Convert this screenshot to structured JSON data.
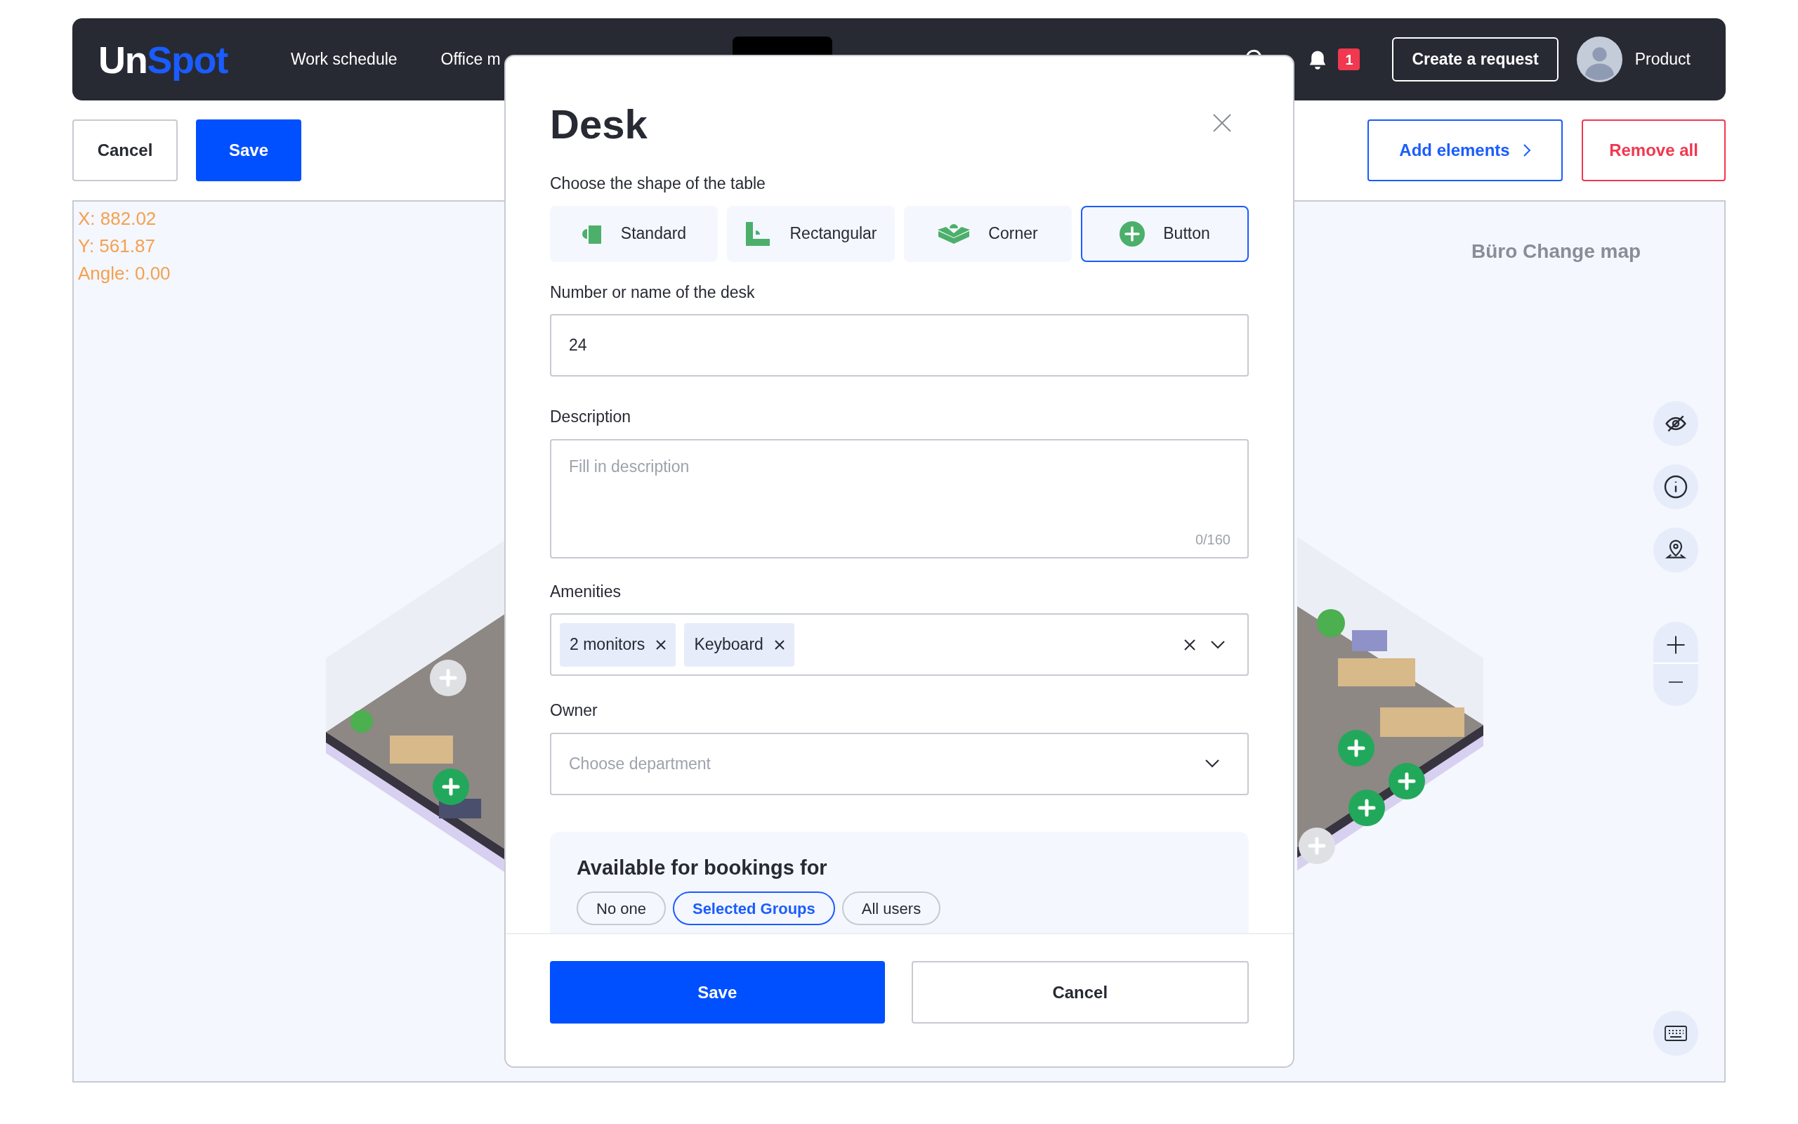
{
  "header": {
    "logo": {
      "part_1": "Un",
      "part_2": "Spot"
    },
    "nav": [
      {
        "label": "Work schedule",
        "selected": false
      },
      {
        "label": "Office m",
        "selected": false
      }
    ],
    "notification_count": "1",
    "create_button": "Create a request",
    "user_name": "Product"
  },
  "toolbar": {
    "cancel": "Cancel",
    "save": "Save",
    "add_elements": "Add elements",
    "remove_all": "Remove all"
  },
  "canvas": {
    "coordinates": [
      "X: 882.02",
      "Y: 561.87",
      "Angle: 0.00"
    ],
    "map_title": "Büro Change map",
    "markers": [
      {
        "active": false
      },
      {
        "active": true
      },
      {
        "active": true
      },
      {
        "active": true
      },
      {
        "active": true
      },
      {
        "active": false
      }
    ]
  },
  "dialog": {
    "title": "Desk",
    "shape_label": "Choose the shape of the table",
    "shapes": [
      {
        "label": "Standard",
        "kind": "standard",
        "selected": false
      },
      {
        "label": "Rectangular",
        "kind": "rectangular",
        "selected": false
      },
      {
        "label": "Corner",
        "kind": "corner",
        "selected": false
      },
      {
        "label": "Button",
        "kind": "button",
        "selected": true
      }
    ],
    "name": {
      "label": "Number or name of the desk",
      "value": "24"
    },
    "description": {
      "label": "Description",
      "placeholder": "Fill in description",
      "counter": "0/160"
    },
    "amenities": {
      "label": "Amenities",
      "chips": [
        "2 monitors",
        "Keyboard"
      ]
    },
    "owner": {
      "label": "Owner",
      "placeholder": "Choose department"
    },
    "bookings": {
      "title": "Available for bookings for",
      "options": [
        {
          "label": "No one",
          "selected": false
        },
        {
          "label": "Selected Groups",
          "selected": true
        },
        {
          "label": "All users",
          "selected": false
        }
      ]
    },
    "save": "Save",
    "cancel": "Cancel"
  }
}
